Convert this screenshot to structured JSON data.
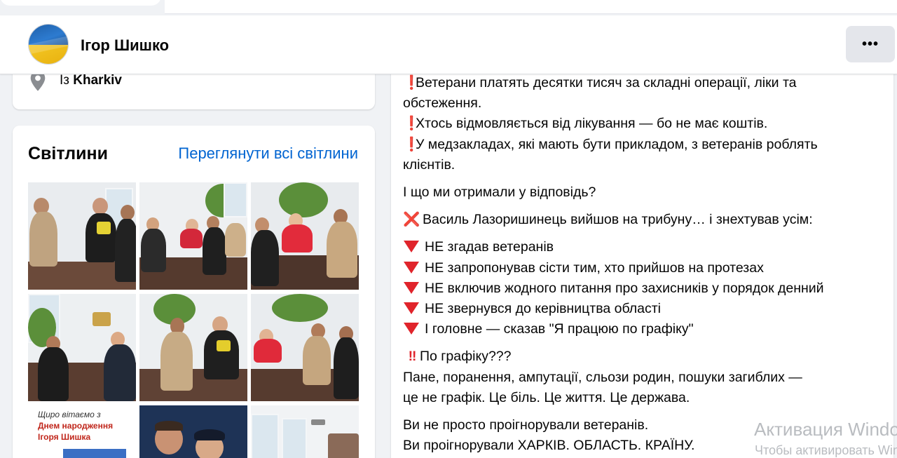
{
  "profile": {
    "name": "Ігор Шишко",
    "more_label": "•••"
  },
  "intro": {
    "location_prefix": "Із",
    "location_city": "Kharkiv"
  },
  "photos": {
    "title": "Світлини",
    "see_all": "Переглянути всі світлини",
    "greeting_line1": "Щиро вітаємо з",
    "greeting_line2": "Днем народження",
    "greeting_line3": "Ігоря Шишка"
  },
  "post": {
    "lines": [
      {
        "icon": "❗",
        "text": "Ветерани платять десятки тисяч за складні операції, ліки та"
      },
      {
        "icon": "",
        "text": "обстеження."
      },
      {
        "icon": "❗",
        "text": "Хтось відмовляється від лікування — бо не має коштів."
      },
      {
        "icon": "❗",
        "text": "У медзакладах, які мають бути прикладом, з ветеранів роблять"
      },
      {
        "icon": "",
        "text": "клієнтів."
      },
      {
        "icon": "",
        "text": "І що ми отримали у відповідь?"
      },
      {
        "icon": "❌",
        "text": "Василь Лазоришинець вийшов на трибуну… і знехтував усім:"
      },
      {
        "icon": "🔻",
        "text": "НЕ згадав ветеранів"
      },
      {
        "icon": "🔻",
        "text": "НЕ запропонував сісти тим, хто прийшов на протезах"
      },
      {
        "icon": "🔻",
        "text": "НЕ включив жодного питання про захисників у порядок денний"
      },
      {
        "icon": "🔻",
        "text": "НЕ звернувся до керівництва області"
      },
      {
        "icon": "🔻",
        "text": "І головне — сказав \"Я працюю по графіку\""
      },
      {
        "icon": "‼",
        "text": "По графіку???"
      },
      {
        "icon": "",
        "text": "Пане, поранення, ампутації, сльози родин, пошуки загиблих —"
      },
      {
        "icon": "",
        "text": "це не графік. Це біль. Це життя. Це держава."
      },
      {
        "icon": "",
        "text": "Ви не просто проігнорували ветеранів."
      },
      {
        "icon": "",
        "text": "Ви проігнорували ХАРКІВ. ОБЛАСТЬ. КРАЇНУ."
      }
    ]
  },
  "watermark": {
    "line1": "Активация Windows",
    "line2": "Чтобы активировать Windows"
  },
  "colors": {
    "link": "#0064d1",
    "emoji_red": "#e0242b",
    "bg": "#f0f2f5"
  }
}
